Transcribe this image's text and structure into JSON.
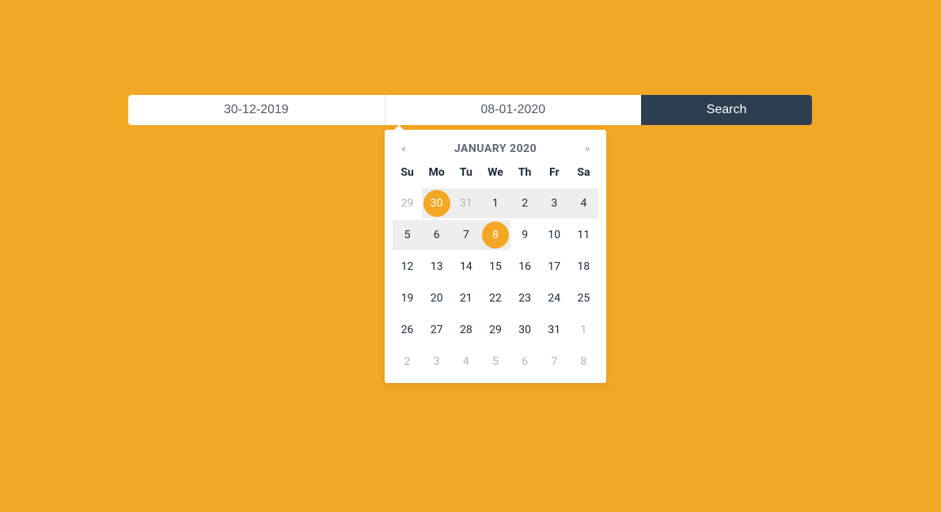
{
  "search": {
    "start_date": "30-12-2019",
    "end_date": "08-01-2020",
    "button_label": "Search"
  },
  "calendar": {
    "title": "JANUARY 2020",
    "prev_glyph": "«",
    "next_glyph": "»",
    "dow": [
      "Su",
      "Mo",
      "Tu",
      "We",
      "Th",
      "Fr",
      "Sa"
    ],
    "days": [
      {
        "d": 29,
        "other": true
      },
      {
        "d": 30,
        "selected": true,
        "inRange": true,
        "other": true
      },
      {
        "d": 31,
        "inRange": true,
        "other": true
      },
      {
        "d": 1,
        "inRange": true
      },
      {
        "d": 2,
        "inRange": true
      },
      {
        "d": 3,
        "inRange": true
      },
      {
        "d": 4,
        "inRange": true
      },
      {
        "d": 5,
        "inRange": true
      },
      {
        "d": 6,
        "inRange": true
      },
      {
        "d": 7,
        "inRange": true
      },
      {
        "d": 8,
        "selected": true,
        "inRange": true
      },
      {
        "d": 9
      },
      {
        "d": 10
      },
      {
        "d": 11
      },
      {
        "d": 12
      },
      {
        "d": 13
      },
      {
        "d": 14
      },
      {
        "d": 15
      },
      {
        "d": 16
      },
      {
        "d": 17
      },
      {
        "d": 18
      },
      {
        "d": 19
      },
      {
        "d": 20
      },
      {
        "d": 21
      },
      {
        "d": 22
      },
      {
        "d": 23
      },
      {
        "d": 24
      },
      {
        "d": 25
      },
      {
        "d": 26
      },
      {
        "d": 27
      },
      {
        "d": 28
      },
      {
        "d": 29
      },
      {
        "d": 30
      },
      {
        "d": 31
      },
      {
        "d": 1,
        "other": true
      },
      {
        "d": 2,
        "other": true
      },
      {
        "d": 3,
        "other": true
      },
      {
        "d": 4,
        "other": true
      },
      {
        "d": 5,
        "other": true
      },
      {
        "d": 6,
        "other": true
      },
      {
        "d": 7,
        "other": true
      },
      {
        "d": 8,
        "other": true
      }
    ]
  }
}
